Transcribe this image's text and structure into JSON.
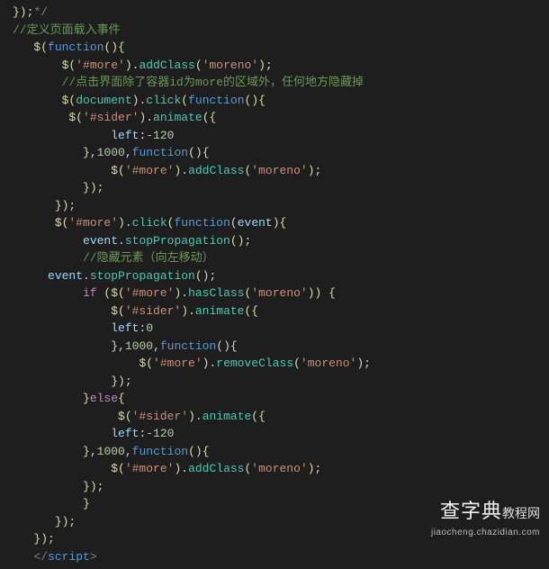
{
  "lines": [
    [
      {
        "cls": "c-yellow",
        "t": "})"
      },
      {
        "cls": "c-white",
        "t": ";"
      },
      {
        "cls": "c-comment",
        "t": "*/"
      }
    ],
    [
      {
        "cls": "c-comment",
        "t": "//定义页面载入事件"
      }
    ],
    [
      {
        "cls": "c-white",
        "t": "   "
      },
      {
        "cls": "c-yellow",
        "t": "$("
      },
      {
        "cls": "c-blue",
        "t": "function"
      },
      {
        "cls": "c-yellow",
        "t": "(){"
      }
    ],
    [
      {
        "cls": "c-white",
        "t": "       "
      },
      {
        "cls": "c-yellow",
        "t": "$("
      },
      {
        "cls": "c-orange",
        "t": "'#more'"
      },
      {
        "cls": "c-yellow",
        "t": ")"
      },
      {
        "cls": "c-white",
        "t": "."
      },
      {
        "cls": "c-teal",
        "t": "addClass"
      },
      {
        "cls": "c-yellow",
        "t": "("
      },
      {
        "cls": "c-orange",
        "t": "'moreno'"
      },
      {
        "cls": "c-yellow",
        "t": ")"
      },
      {
        "cls": "c-white",
        "t": ";"
      }
    ],
    [
      {
        "cls": "c-white",
        "t": "       "
      },
      {
        "cls": "c-comment",
        "t": "//点击界面除了容器id为more的区域外，任何地方隐藏掉"
      }
    ],
    [
      {
        "cls": "c-white",
        "t": "       "
      },
      {
        "cls": "c-yellow",
        "t": "$("
      },
      {
        "cls": "c-teal",
        "t": "document"
      },
      {
        "cls": "c-yellow",
        "t": ")"
      },
      {
        "cls": "c-white",
        "t": "."
      },
      {
        "cls": "c-teal",
        "t": "click"
      },
      {
        "cls": "c-yellow",
        "t": "("
      },
      {
        "cls": "c-blue",
        "t": "function"
      },
      {
        "cls": "c-yellow",
        "t": "(){"
      }
    ],
    [
      {
        "cls": "c-white",
        "t": "        "
      },
      {
        "cls": "c-yellow",
        "t": "$("
      },
      {
        "cls": "c-orange",
        "t": "'#sider'"
      },
      {
        "cls": "c-yellow",
        "t": ")"
      },
      {
        "cls": "c-white",
        "t": "."
      },
      {
        "cls": "c-teal",
        "t": "animate"
      },
      {
        "cls": "c-yellow",
        "t": "({"
      }
    ],
    [
      {
        "cls": "c-white",
        "t": "              "
      },
      {
        "cls": "c-ltblue",
        "t": "left"
      },
      {
        "cls": "c-white",
        "t": ":"
      },
      {
        "cls": "c-num",
        "t": "-120"
      }
    ],
    [
      {
        "cls": "c-white",
        "t": "          "
      },
      {
        "cls": "c-yellow",
        "t": "}"
      },
      {
        "cls": "c-white",
        "t": ","
      },
      {
        "cls": "c-num",
        "t": "1000"
      },
      {
        "cls": "c-white",
        "t": ","
      },
      {
        "cls": "c-blue",
        "t": "function"
      },
      {
        "cls": "c-yellow",
        "t": "(){"
      }
    ],
    [
      {
        "cls": "c-white",
        "t": "              "
      },
      {
        "cls": "c-yellow",
        "t": "$("
      },
      {
        "cls": "c-orange",
        "t": "'#more'"
      },
      {
        "cls": "c-yellow",
        "t": ")"
      },
      {
        "cls": "c-white",
        "t": "."
      },
      {
        "cls": "c-teal",
        "t": "addClass"
      },
      {
        "cls": "c-yellow",
        "t": "("
      },
      {
        "cls": "c-orange",
        "t": "'moreno'"
      },
      {
        "cls": "c-yellow",
        "t": ")"
      },
      {
        "cls": "c-white",
        "t": ";"
      }
    ],
    [
      {
        "cls": "c-white",
        "t": "          "
      },
      {
        "cls": "c-yellow",
        "t": "})"
      },
      {
        "cls": "c-white",
        "t": ";"
      }
    ],
    [
      {
        "cls": "c-white",
        "t": "      "
      },
      {
        "cls": "c-yellow",
        "t": "})"
      },
      {
        "cls": "c-white",
        "t": ";"
      }
    ],
    [
      {
        "cls": "c-white",
        "t": "      "
      },
      {
        "cls": "c-yellow",
        "t": "$("
      },
      {
        "cls": "c-orange",
        "t": "'#more'"
      },
      {
        "cls": "c-yellow",
        "t": ")"
      },
      {
        "cls": "c-white",
        "t": "."
      },
      {
        "cls": "c-teal",
        "t": "click"
      },
      {
        "cls": "c-yellow",
        "t": "("
      },
      {
        "cls": "c-blue",
        "t": "function"
      },
      {
        "cls": "c-yellow",
        "t": "("
      },
      {
        "cls": "c-ltblue",
        "t": "event"
      },
      {
        "cls": "c-yellow",
        "t": "){"
      }
    ],
    [
      {
        "cls": "c-white",
        "t": "          "
      },
      {
        "cls": "c-ltblue",
        "t": "event"
      },
      {
        "cls": "c-white",
        "t": "."
      },
      {
        "cls": "c-teal",
        "t": "stopPropagation"
      },
      {
        "cls": "c-yellow",
        "t": "()"
      },
      {
        "cls": "c-white",
        "t": ";"
      }
    ],
    [
      {
        "cls": "c-white",
        "t": "          "
      },
      {
        "cls": "c-comment",
        "t": "//隐藏元素（向左移动）"
      }
    ],
    [
      {
        "cls": "c-white",
        "t": "     "
      },
      {
        "cls": "c-ltblue",
        "t": "event"
      },
      {
        "cls": "c-white",
        "t": "."
      },
      {
        "cls": "c-teal",
        "t": "stopPropagation"
      },
      {
        "cls": "c-yellow",
        "t": "()"
      },
      {
        "cls": "c-white",
        "t": ";"
      }
    ],
    [
      {
        "cls": "c-white",
        "t": "          "
      },
      {
        "cls": "c-purple",
        "t": "if "
      },
      {
        "cls": "c-yellow",
        "t": "("
      },
      {
        "cls": "c-yellow",
        "t": "$("
      },
      {
        "cls": "c-orange",
        "t": "'#more'"
      },
      {
        "cls": "c-yellow",
        "t": ")"
      },
      {
        "cls": "c-white",
        "t": "."
      },
      {
        "cls": "c-teal",
        "t": "hasClass"
      },
      {
        "cls": "c-yellow",
        "t": "("
      },
      {
        "cls": "c-orange",
        "t": "'moreno'"
      },
      {
        "cls": "c-yellow",
        "t": "))"
      },
      {
        "cls": "c-white",
        "t": " "
      },
      {
        "cls": "c-yellow",
        "t": "{"
      }
    ],
    [
      {
        "cls": "c-white",
        "t": "              "
      },
      {
        "cls": "c-yellow",
        "t": "$("
      },
      {
        "cls": "c-orange",
        "t": "'#sider'"
      },
      {
        "cls": "c-yellow",
        "t": ")"
      },
      {
        "cls": "c-white",
        "t": "."
      },
      {
        "cls": "c-teal",
        "t": "animate"
      },
      {
        "cls": "c-yellow",
        "t": "({"
      }
    ],
    [
      {
        "cls": "c-white",
        "t": "              "
      },
      {
        "cls": "c-ltblue",
        "t": "left"
      },
      {
        "cls": "c-white",
        "t": ":"
      },
      {
        "cls": "c-num",
        "t": "0"
      }
    ],
    [
      {
        "cls": "c-white",
        "t": "              "
      },
      {
        "cls": "c-yellow",
        "t": "}"
      },
      {
        "cls": "c-white",
        "t": ","
      },
      {
        "cls": "c-num",
        "t": "1000"
      },
      {
        "cls": "c-white",
        "t": ","
      },
      {
        "cls": "c-blue",
        "t": "function"
      },
      {
        "cls": "c-yellow",
        "t": "(){"
      }
    ],
    [
      {
        "cls": "c-white",
        "t": "                  "
      },
      {
        "cls": "c-yellow",
        "t": "$("
      },
      {
        "cls": "c-orange",
        "t": "'#more'"
      },
      {
        "cls": "c-yellow",
        "t": ")"
      },
      {
        "cls": "c-white",
        "t": "."
      },
      {
        "cls": "c-teal",
        "t": "removeClass"
      },
      {
        "cls": "c-yellow",
        "t": "("
      },
      {
        "cls": "c-orange",
        "t": "'moreno'"
      },
      {
        "cls": "c-yellow",
        "t": ")"
      },
      {
        "cls": "c-white",
        "t": ";"
      }
    ],
    [
      {
        "cls": "c-white",
        "t": "              "
      },
      {
        "cls": "c-yellow",
        "t": "})"
      },
      {
        "cls": "c-white",
        "t": ";"
      }
    ],
    [
      {
        "cls": "c-white",
        "t": "          "
      },
      {
        "cls": "c-yellow",
        "t": "}"
      },
      {
        "cls": "c-purple",
        "t": "else"
      },
      {
        "cls": "c-yellow",
        "t": "{"
      }
    ],
    [
      {
        "cls": "c-white",
        "t": "               "
      },
      {
        "cls": "c-yellow",
        "t": "$("
      },
      {
        "cls": "c-orange",
        "t": "'#sider'"
      },
      {
        "cls": "c-yellow",
        "t": ")"
      },
      {
        "cls": "c-white",
        "t": "."
      },
      {
        "cls": "c-teal",
        "t": "animate"
      },
      {
        "cls": "c-yellow",
        "t": "({"
      }
    ],
    [
      {
        "cls": "c-white",
        "t": "              "
      },
      {
        "cls": "c-ltblue",
        "t": "left"
      },
      {
        "cls": "c-white",
        "t": ":"
      },
      {
        "cls": "c-num",
        "t": "-120"
      }
    ],
    [
      {
        "cls": "c-white",
        "t": "          "
      },
      {
        "cls": "c-yellow",
        "t": "}"
      },
      {
        "cls": "c-white",
        "t": ","
      },
      {
        "cls": "c-num",
        "t": "1000"
      },
      {
        "cls": "c-white",
        "t": ","
      },
      {
        "cls": "c-blue",
        "t": "function"
      },
      {
        "cls": "c-yellow",
        "t": "(){"
      }
    ],
    [
      {
        "cls": "c-white",
        "t": "              "
      },
      {
        "cls": "c-yellow",
        "t": "$("
      },
      {
        "cls": "c-orange",
        "t": "'#more'"
      },
      {
        "cls": "c-yellow",
        "t": ")"
      },
      {
        "cls": "c-white",
        "t": "."
      },
      {
        "cls": "c-teal",
        "t": "addClass"
      },
      {
        "cls": "c-yellow",
        "t": "("
      },
      {
        "cls": "c-orange",
        "t": "'moreno'"
      },
      {
        "cls": "c-yellow",
        "t": ")"
      },
      {
        "cls": "c-white",
        "t": ";"
      }
    ],
    [
      {
        "cls": "c-white",
        "t": "          "
      },
      {
        "cls": "c-yellow",
        "t": "})"
      },
      {
        "cls": "c-white",
        "t": ";"
      }
    ],
    [
      {
        "cls": "c-white",
        "t": "          "
      },
      {
        "cls": "c-yellow",
        "t": "}"
      }
    ],
    [
      {
        "cls": "c-white",
        "t": "      "
      },
      {
        "cls": "c-yellow",
        "t": "})"
      },
      {
        "cls": "c-white",
        "t": ";"
      }
    ],
    [
      {
        "cls": "c-white",
        "t": "   "
      },
      {
        "cls": "c-yellow",
        "t": "})"
      },
      {
        "cls": "c-white",
        "t": ";"
      }
    ],
    [
      {
        "cls": "c-white",
        "t": "   "
      },
      {
        "cls": "c-gray",
        "t": "</"
      },
      {
        "cls": "c-blue",
        "t": "script"
      },
      {
        "cls": "c-gray",
        "t": ">"
      }
    ]
  ],
  "watermark": {
    "main": "查字典",
    "suffix": "教程网",
    "url": "jiaocheng.chazidian.com"
  }
}
